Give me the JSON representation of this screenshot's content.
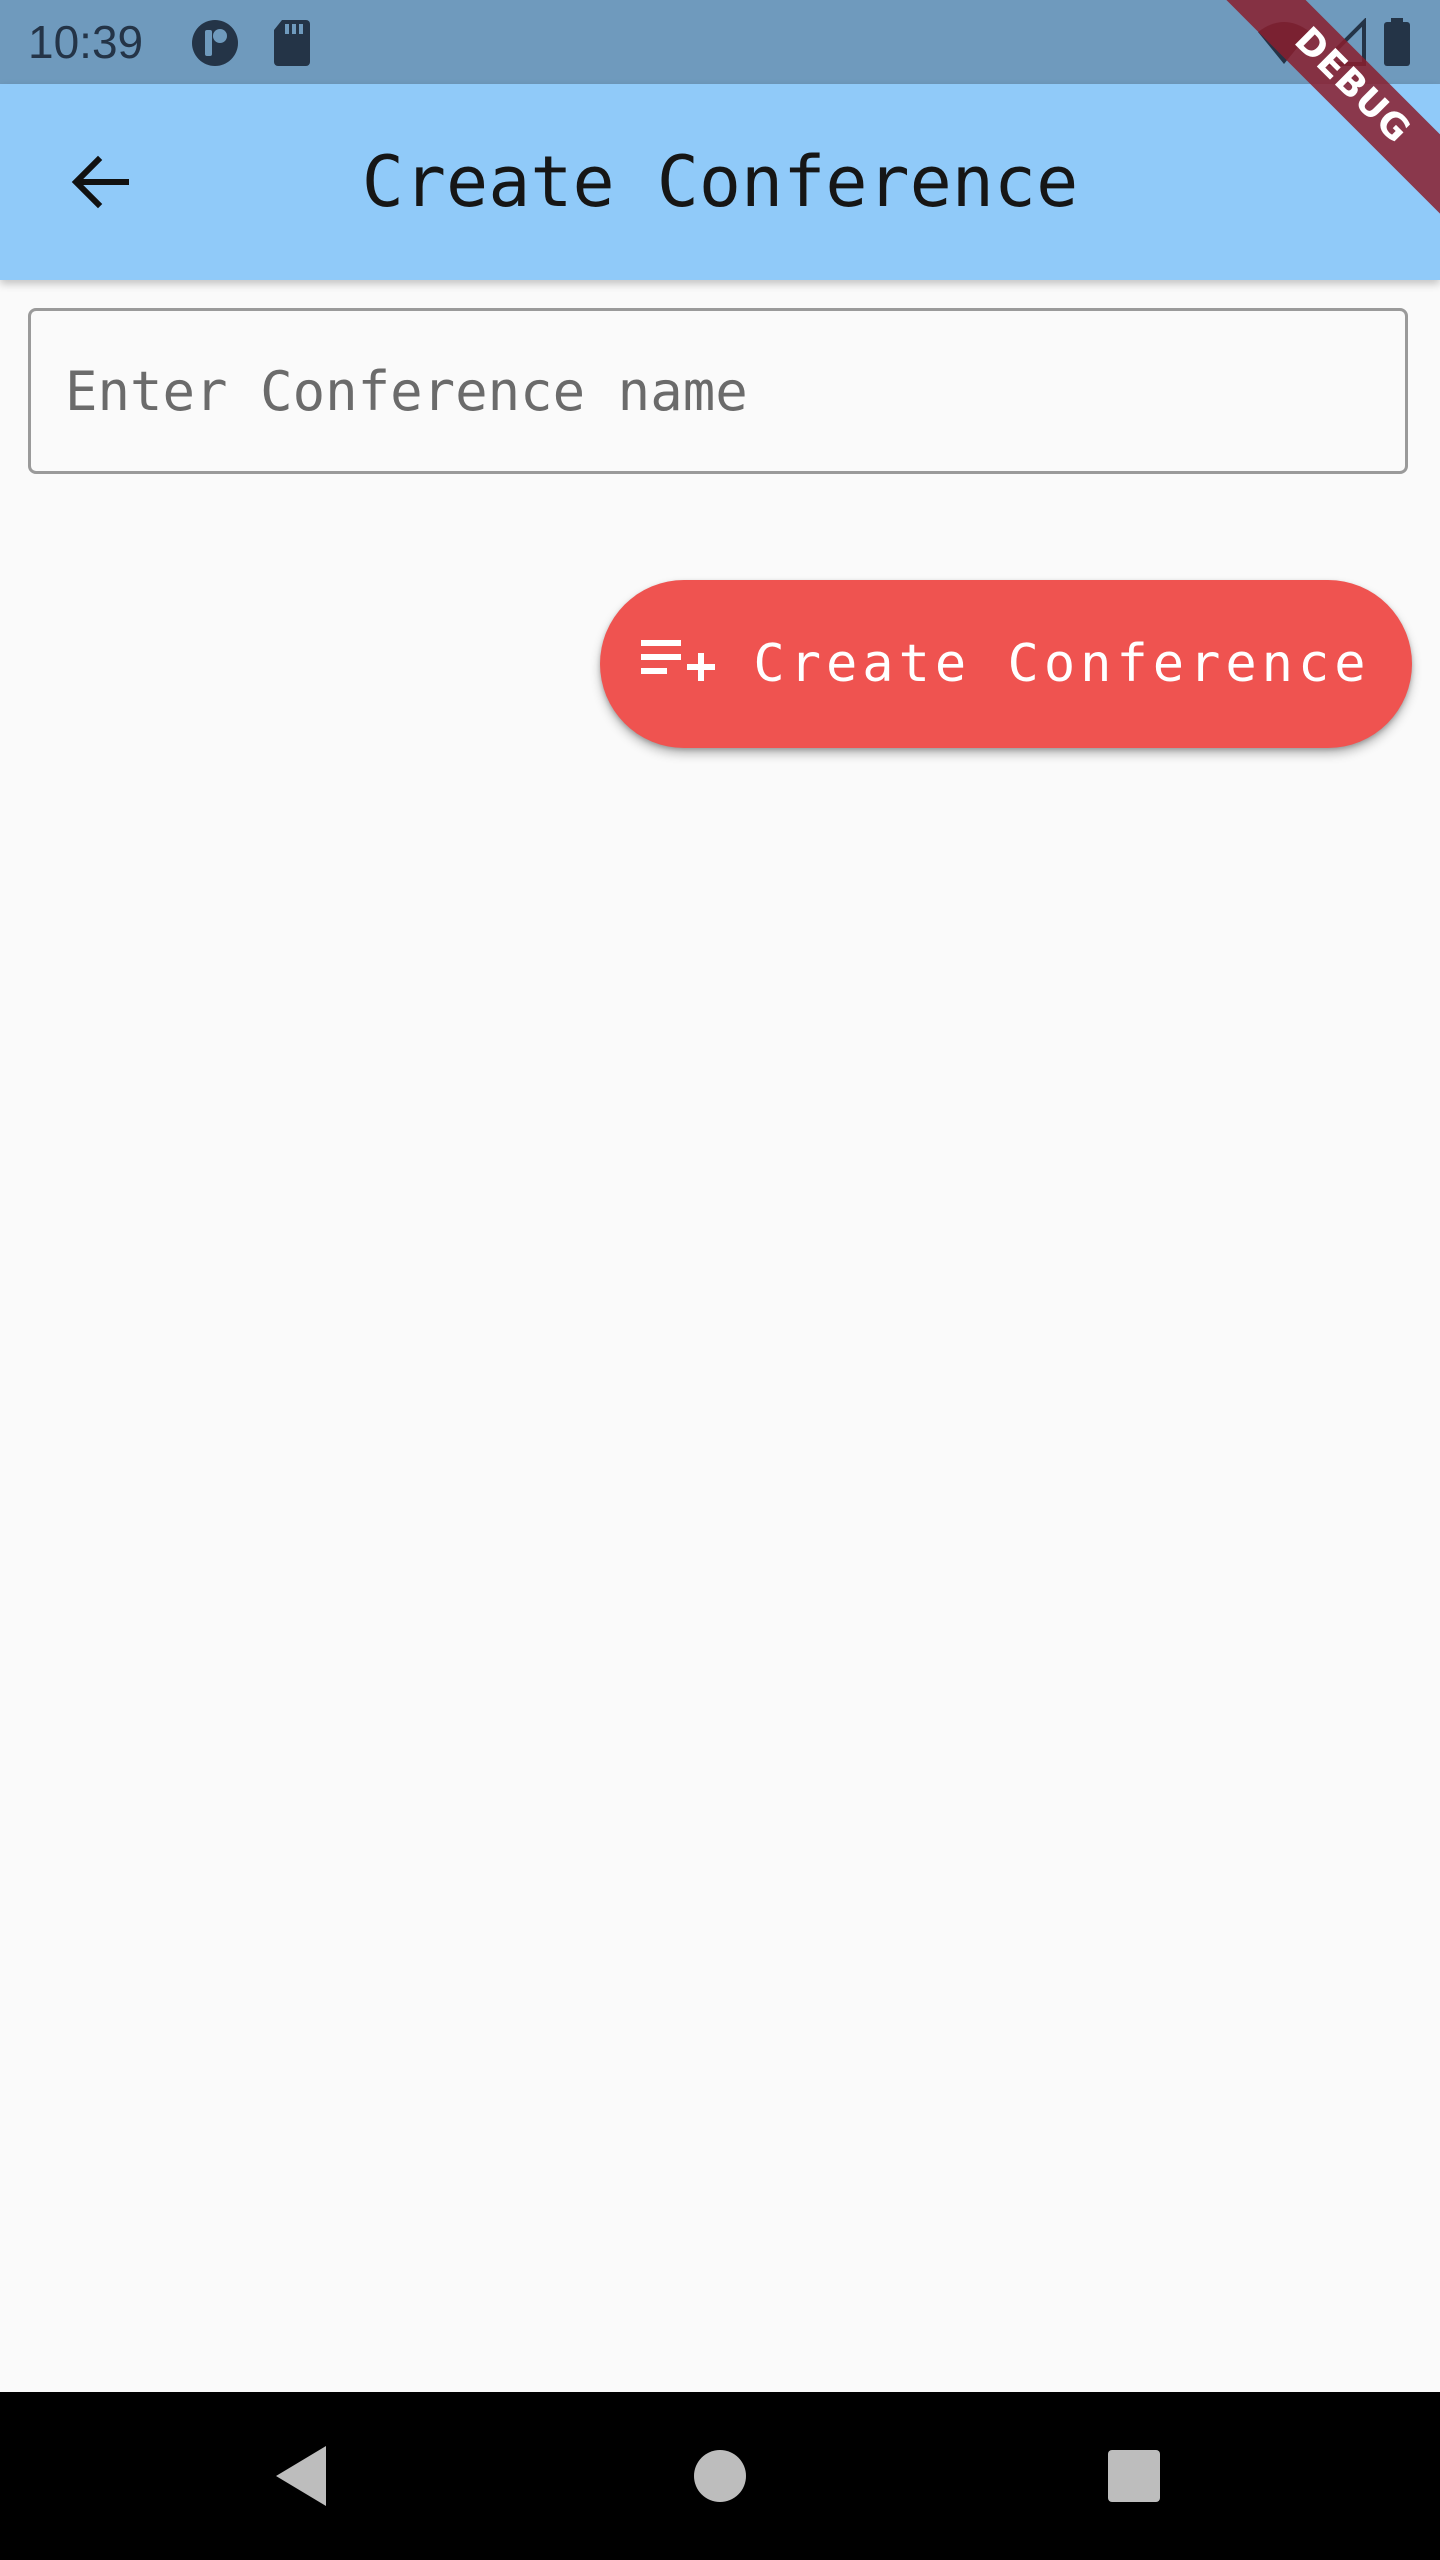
{
  "status_bar": {
    "time": "10:39",
    "icons": [
      "media-icon",
      "sd-card-icon",
      "wifi-icon",
      "signal-icon",
      "battery-icon"
    ]
  },
  "debug_banner": {
    "label": "DEBUG"
  },
  "app_bar": {
    "title": "Create Conference",
    "back_icon": "arrow-back-icon",
    "background": "#90caf9"
  },
  "form": {
    "name_field": {
      "placeholder": "Enter Conference name",
      "value": ""
    }
  },
  "fab": {
    "label": "Create Conference",
    "icon": "playlist-add-icon",
    "color": "#ef5350"
  },
  "nav_bar": {
    "buttons": [
      "back-triangle-icon",
      "home-circle-icon",
      "recents-square-icon"
    ]
  }
}
